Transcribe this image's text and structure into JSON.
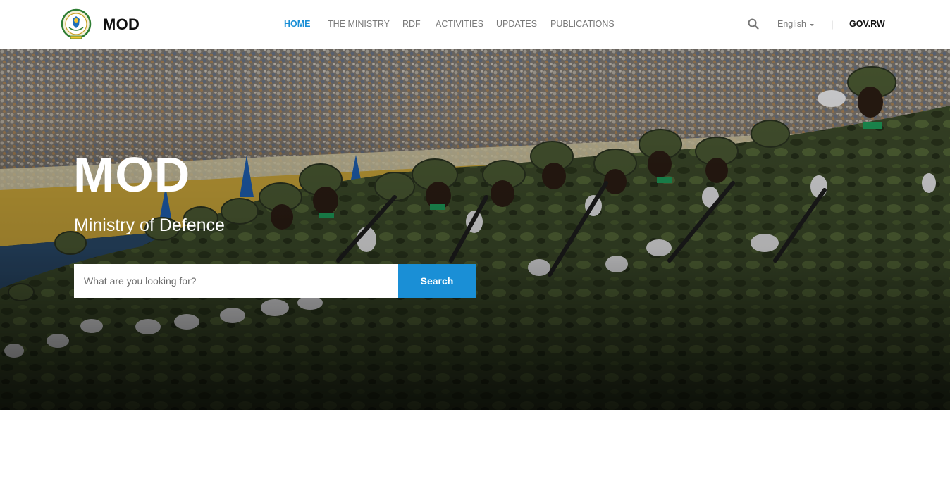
{
  "header": {
    "brand": "MOD",
    "nav": [
      {
        "label": "HOME",
        "active": true
      },
      {
        "label": "THE MINISTRY",
        "active": false
      },
      {
        "label": "RDF",
        "active": false
      },
      {
        "label": "ACTIVITIES",
        "active": false
      },
      {
        "label": "UPDATES",
        "active": false
      },
      {
        "label": "PUBLICATIONS",
        "active": false
      }
    ],
    "search_icon": "search-icon",
    "language": "English",
    "separator": "|",
    "gov_link": "GOV.RW"
  },
  "hero": {
    "title": "MOD",
    "subtitle": "Ministry of Defence",
    "search_placeholder": "What are you looking for?",
    "search_button": "Search"
  },
  "colors": {
    "accent": "#1a8fd6",
    "text_dark": "#111111",
    "nav_text": "#7a7a7a"
  }
}
